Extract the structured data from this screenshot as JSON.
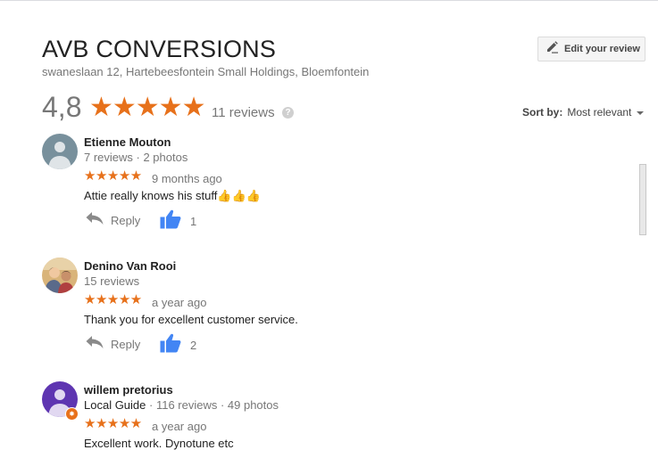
{
  "place": {
    "name": "AVB CONVERSIONS",
    "address": "swaneslaan 12, Hartebeesfontein Small Holdings, Bloemfontein"
  },
  "edit_review": {
    "label": "Edit your review",
    "icon": "pencil-icon"
  },
  "summary": {
    "rating": "4,8",
    "stars": "★★★★★",
    "review_count": "11 reviews",
    "help": "?"
  },
  "sort": {
    "label": "Sort by:",
    "value": "Most relevant"
  },
  "colors": {
    "star": "#e7711b",
    "like": "#4285f4",
    "local_guide": "#e8711b"
  },
  "reviews": [
    {
      "name": "Etienne Mouton",
      "meta": "7 reviews · 2 photos",
      "stars": "★★★★★",
      "time": "9 months ago",
      "text": "Attie really knows his stuff👍👍👍",
      "reply": "Reply",
      "likes": "1"
    },
    {
      "name": "Denino Van Rooi",
      "meta": "15 reviews",
      "stars": "★★★★★",
      "time": "a year ago",
      "text": "Thank you for excellent customer service.",
      "reply": "Reply",
      "likes": "2"
    },
    {
      "name": "willem pretorius",
      "guide": "Local Guide",
      "meta": " · 116 reviews · 49 photos",
      "stars": "★★★★★",
      "time": "a year ago",
      "text": "Excellent work. Dynotune etc"
    }
  ]
}
